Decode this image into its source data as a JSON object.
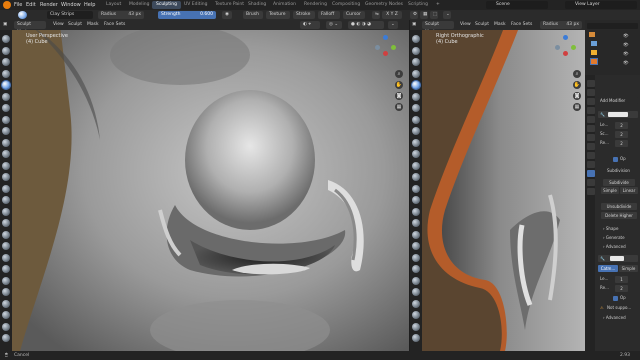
{
  "menu": [
    "File",
    "Edit",
    "Render",
    "Window",
    "Help"
  ],
  "workspaces": [
    "Layout",
    "Modeling",
    "Sculpting",
    "UV Editing",
    "Texture Paint",
    "Shading",
    "Animation",
    "Rendering",
    "Compositing",
    "Geometry Nodes",
    "Scripting"
  ],
  "active_workspace": "Sculpting",
  "scene": {
    "name": "Scene",
    "view_layer": "View Layer"
  },
  "toolbar": {
    "brush": "Clay Strips",
    "radius_label": "Radius",
    "radius_value": "43 px",
    "strength_label": "Strength",
    "strength_value": "0.600",
    "items": [
      "Brush",
      "Texture",
      "Stroke",
      "Falloff",
      "Cursor"
    ]
  },
  "viewport_left": {
    "mode": "Sculpt Mode",
    "menus": [
      "View",
      "Sculpt",
      "Mask",
      "Face Sets"
    ],
    "view_name": "User Perspective",
    "object": "(4) Cube"
  },
  "viewport_right": {
    "mode": "Sculpt Mode",
    "menus": [
      "View",
      "Sculpt",
      "Mask",
      "Face Sets"
    ],
    "view_name": "Right Orthographic",
    "object": "(4) Cube",
    "radius_label": "Radius",
    "radius_value": "43 px"
  },
  "properties": {
    "add_modifier": "Add Modifier",
    "subdivision": "Subdivision",
    "subdivide": "Subdivide",
    "simple": "Simple",
    "linear": "Linear",
    "unsubdivide": "Unsubdivide",
    "delete_higher": "Delete Higher",
    "shape": "Shape",
    "generate": "Generate",
    "advanced": "Advanced",
    "catmull": "Catm...",
    "simple2": "Simple",
    "levels_labels": [
      "Le...",
      "Sc...",
      "Re..."
    ],
    "levels_labels2": [
      "Le...",
      "Re..."
    ],
    "levels_values": [
      "2",
      "2",
      "2"
    ],
    "levels_values2": [
      "1",
      "2"
    ],
    "opt": "Op",
    "not_supported": "Not suppo...",
    "advanced2": "Advanced"
  },
  "status": {
    "left": "Cancel",
    "right": "2.93"
  },
  "colors": {
    "accent": "#4772b3",
    "background": "#1d1d1d",
    "header": "#2a2a2a"
  }
}
